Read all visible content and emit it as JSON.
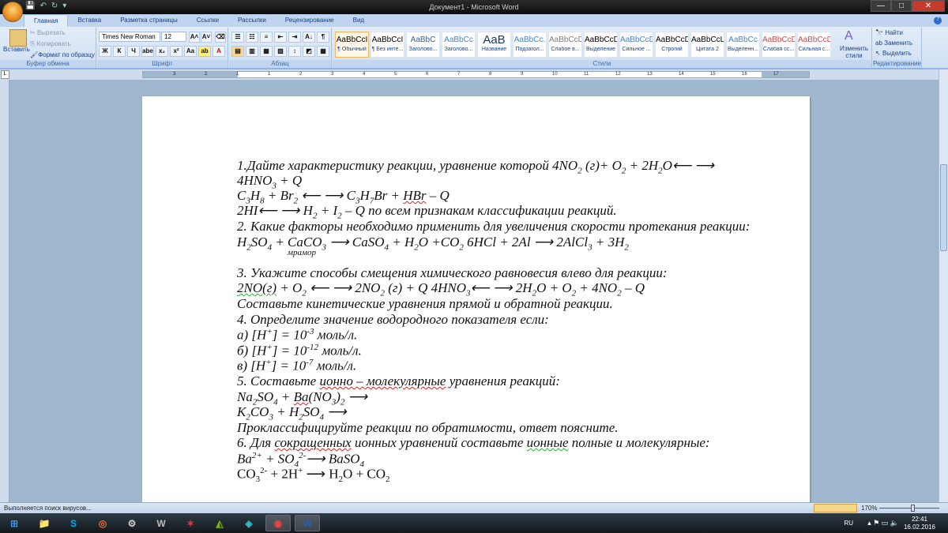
{
  "window": {
    "title": "Документ1 - Microsoft Word",
    "min": "—",
    "max": "□",
    "close": "✕"
  },
  "qat": {
    "save": "💾",
    "undo": "↶",
    "redo": "↻",
    "more": "▾"
  },
  "tabs": [
    "Главная",
    "Вставка",
    "Разметка страницы",
    "Ссылки",
    "Рассылки",
    "Рецензирование",
    "Вид"
  ],
  "clipboard": {
    "paste": "Вставить",
    "cut": "Вырезать",
    "copy": "Копировать",
    "format": "Формат по образцу",
    "label": "Буфер обмена"
  },
  "font": {
    "name": "Times New Roman",
    "size": "12",
    "label": "Шрифт",
    "buttons": [
      "Ж",
      "К",
      "Ч",
      "abe",
      "x₂",
      "x²",
      "Aa",
      "ab",
      "A"
    ],
    "grow": "A˄",
    "shrink": "A˅"
  },
  "paragraph": {
    "label": "Абзац",
    "buttons": [
      "☰",
      "☷",
      "≡",
      "⇤",
      "⇥",
      "A↓",
      "¶",
      "▤",
      "▥",
      "▦",
      "▧",
      "↕",
      "◩",
      "▦"
    ]
  },
  "styles": {
    "label": "Стили",
    "items": [
      {
        "preview": "AaBbCcI",
        "name": "¶ Обычный",
        "color": "#000"
      },
      {
        "preview": "AaBbCcI",
        "name": "¶ Без инте...",
        "color": "#000"
      },
      {
        "preview": "AaBbC",
        "name": "Заголово...",
        "color": "#365f91"
      },
      {
        "preview": "AaBbCc",
        "name": "Заголово...",
        "color": "#4f81bd"
      },
      {
        "preview": "AaB",
        "name": "Название",
        "color": "#17365d"
      },
      {
        "preview": "AaBbCc.",
        "name": "Подзагол...",
        "color": "#4f81bd"
      },
      {
        "preview": "AaBbCcD",
        "name": "Слабое в...",
        "color": "#808080"
      },
      {
        "preview": "AaBbCcD",
        "name": "Выделение",
        "color": "#000"
      },
      {
        "preview": "AaBbCcD",
        "name": "Сильное ...",
        "color": "#4f81bd"
      },
      {
        "preview": "AaBbCcD",
        "name": "Строгий",
        "color": "#000"
      },
      {
        "preview": "AaBbCcL",
        "name": "Цитата 2",
        "color": "#000"
      },
      {
        "preview": "AaBbCc",
        "name": "Выделенн...",
        "color": "#4f81bd"
      },
      {
        "preview": "AaBbCcD",
        "name": "Слабая сс...",
        "color": "#c0504d"
      },
      {
        "preview": "AaBbCcD",
        "name": "Сильная с...",
        "color": "#c0504d"
      }
    ],
    "change": "Изменить стили"
  },
  "editing": {
    "find": "Найти",
    "replace": "Заменить",
    "select": "Выделить",
    "label": "Редактирование"
  },
  "ruler": [
    "3",
    "2",
    "1",
    "1",
    "2",
    "3",
    "4",
    "5",
    "6",
    "7",
    "8",
    "9",
    "10",
    "11",
    "12",
    "13",
    "14",
    "15",
    "16",
    "17"
  ],
  "document": {
    "lines": [
      {
        "segs": [
          [
            "1.Дайте характеристику реакции, уравнение которой 4NO",
            ""
          ],
          [
            "2",
            "b"
          ],
          [
            " (г)+ O",
            ""
          ],
          [
            "2",
            "b"
          ],
          [
            " + 2H",
            ""
          ],
          [
            "2",
            "b"
          ],
          [
            "O⟵ ⟶",
            ""
          ]
        ]
      },
      {
        "segs": [
          [
            "4HNO",
            ""
          ],
          [
            "3",
            "b"
          ],
          [
            " + Q",
            ""
          ]
        ]
      },
      {
        "segs": [
          [
            " C",
            ""
          ],
          [
            "3",
            "b"
          ],
          [
            "H",
            ""
          ],
          [
            "8",
            "b"
          ],
          [
            " + Br",
            ""
          ],
          [
            "2",
            "b"
          ],
          [
            "   ⟵ ⟶  C",
            ""
          ],
          [
            "3",
            "b"
          ],
          [
            "H",
            ""
          ],
          [
            "7",
            "b"
          ],
          [
            "Br + ",
            ""
          ],
          [
            "HBr",
            "u"
          ],
          [
            " – Q",
            ""
          ]
        ]
      },
      {
        "segs": [
          [
            "2HI⟵ ⟶  H",
            ""
          ],
          [
            "2",
            "b"
          ],
          [
            " + I",
            ""
          ],
          [
            "2",
            "b"
          ],
          [
            " – Q по всем признакам классификации реакций.",
            ""
          ]
        ]
      },
      {
        "segs": [
          [
            "2. Какие факторы необходимо применить для увеличения скорости протекания реакции:",
            ""
          ]
        ]
      },
      {
        "segs": [
          [
            "H",
            ""
          ],
          [
            "2",
            "b"
          ],
          [
            "SO",
            ""
          ],
          [
            "4",
            "b"
          ],
          [
            " + CaCO",
            ""
          ],
          [
            "3",
            "b"
          ],
          [
            "  ⟶   CaSO",
            ""
          ],
          [
            "4",
            "b"
          ],
          [
            " +   H",
            ""
          ],
          [
            "2",
            "b"
          ],
          [
            "O +CO",
            ""
          ],
          [
            "2",
            "b"
          ],
          [
            "      6HCl + 2Al ⟶ 2AlCl",
            ""
          ],
          [
            "3",
            "b"
          ],
          [
            " + 3H",
            ""
          ],
          [
            "2",
            "b"
          ]
        ]
      },
      {
        "style": "small",
        "segs": [
          [
            "мрамор",
            ""
          ]
        ]
      },
      {
        "segs": [
          [
            "3. Укажите способы смещения химического равновесия влево для реакции:",
            ""
          ]
        ]
      },
      {
        "segs": [
          [
            "2NO(г)",
            "g"
          ],
          [
            " + O",
            ""
          ],
          [
            "2",
            "b"
          ],
          [
            "  ⟵ ⟶   2NO",
            ""
          ],
          [
            "2",
            "b"
          ],
          [
            " (г) + Q     4HNO",
            ""
          ],
          [
            "3",
            "b"
          ],
          [
            "⟵ ⟶    2H",
            ""
          ],
          [
            "2",
            "b"
          ],
          [
            "O + O",
            ""
          ],
          [
            "2",
            "b"
          ],
          [
            " + 4NO",
            ""
          ],
          [
            "2",
            "b"
          ],
          [
            " – Q",
            ""
          ]
        ]
      },
      {
        "segs": [
          [
            "Составьте кинетические уравнения прямой и обратной реакции.",
            ""
          ]
        ]
      },
      {
        "segs": [
          [
            "4. Определите значение водородного показателя если:",
            ""
          ]
        ]
      },
      {
        "segs": [
          [
            "а) [H",
            ""
          ],
          [
            "+",
            "p"
          ],
          [
            "] = 10",
            ""
          ],
          [
            "-3",
            "p"
          ],
          [
            " моль/л.",
            ""
          ]
        ]
      },
      {
        "segs": [
          [
            "б) [H",
            ""
          ],
          [
            "+",
            "p"
          ],
          [
            "] = 10",
            ""
          ],
          [
            "-12",
            "p"
          ],
          [
            " моль/л.",
            ""
          ]
        ]
      },
      {
        "segs": [
          [
            "в) [H",
            ""
          ],
          [
            "+",
            "p"
          ],
          [
            "] = 10",
            ""
          ],
          [
            "-7",
            "p"
          ],
          [
            " моль/л.",
            ""
          ]
        ]
      },
      {
        "segs": [
          [
            "5. Составьте ",
            ""
          ],
          [
            "ионно – молекулярные",
            "u"
          ],
          [
            " уравнения реакций:",
            ""
          ]
        ]
      },
      {
        "segs": [
          [
            "Na",
            ""
          ],
          [
            "2",
            "b"
          ],
          [
            "SO",
            ""
          ],
          [
            "4",
            "b"
          ],
          [
            " + ",
            ""
          ],
          [
            "Ba",
            "u"
          ],
          [
            "(NO",
            ""
          ],
          [
            "3",
            "b"
          ],
          [
            ")",
            ""
          ],
          [
            "2",
            "b"
          ],
          [
            "   ⟶",
            ""
          ]
        ]
      },
      {
        "segs": [
          [
            "K",
            ""
          ],
          [
            "2",
            "b"
          ],
          [
            "CO",
            ""
          ],
          [
            "3",
            "b"
          ],
          [
            " + H",
            ""
          ],
          [
            "2",
            "b"
          ],
          [
            "SO",
            ""
          ],
          [
            "4",
            "b"
          ],
          [
            "      ⟶",
            ""
          ]
        ]
      },
      {
        "segs": [
          [
            "Проклассифицируйте реакции по обратимости, ответ поясните.",
            ""
          ]
        ]
      },
      {
        "segs": [
          [
            "6. Для ",
            ""
          ],
          [
            "сокращенных",
            "u"
          ],
          [
            " ионных уравнений составьте ",
            ""
          ],
          [
            "ионные",
            "g"
          ],
          [
            " полные и молекулярные:",
            ""
          ]
        ]
      },
      {
        "segs": [
          [
            "Ba",
            ""
          ],
          [
            "2+",
            "p"
          ],
          [
            " + SO",
            ""
          ],
          [
            "4",
            "b"
          ],
          [
            "2-",
            "p"
          ],
          [
            "⟶ BaSO",
            ""
          ],
          [
            "4",
            "b"
          ]
        ]
      },
      {
        "style": "normal",
        "segs": [
          [
            "CO",
            ""
          ],
          [
            "3",
            "b"
          ],
          [
            "2-",
            "p"
          ],
          [
            " + 2H",
            ""
          ],
          [
            "+",
            "p"
          ],
          [
            " ⟶ H",
            ""
          ],
          [
            "2",
            "b"
          ],
          [
            "O + CO",
            ""
          ],
          [
            "2",
            "b"
          ]
        ]
      }
    ]
  },
  "status": {
    "text": "Выполняется поиск вирусов...",
    "zoom": "170%"
  },
  "taskbar": {
    "apps": [
      {
        "name": "windows-start",
        "glyph": "⊞",
        "color": "#3a8ee6"
      },
      {
        "name": "explorer",
        "glyph": "📁",
        "color": "#e8c55a"
      },
      {
        "name": "skype",
        "glyph": "S",
        "color": "#00aff0"
      },
      {
        "name": "origin",
        "glyph": "◎",
        "color": "#f56c2d"
      },
      {
        "name": "steam",
        "glyph": "⚙",
        "color": "#ccc"
      },
      {
        "name": "world-of-tanks",
        "glyph": "W",
        "color": "#bbb"
      },
      {
        "name": "app-star",
        "glyph": "✶",
        "color": "#e33"
      },
      {
        "name": "nvidia",
        "glyph": "◭",
        "color": "#76b900"
      },
      {
        "name": "app-shield",
        "glyph": "◈",
        "color": "#3bc"
      },
      {
        "name": "chrome",
        "glyph": "◉",
        "color": "#e44"
      },
      {
        "name": "word",
        "glyph": "W",
        "color": "#2b5fb4"
      }
    ],
    "lang": "RU",
    "time": "22:41",
    "date": "16.02.2016"
  }
}
